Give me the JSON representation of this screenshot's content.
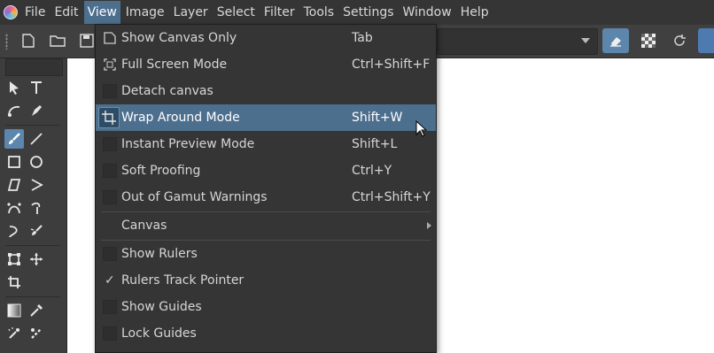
{
  "menubar": {
    "items": [
      {
        "label": "File"
      },
      {
        "label": "Edit"
      },
      {
        "label": "View"
      },
      {
        "label": "Image"
      },
      {
        "label": "Layer"
      },
      {
        "label": "Select"
      },
      {
        "label": "Filter"
      },
      {
        "label": "Tools"
      },
      {
        "label": "Settings"
      },
      {
        "label": "Window"
      },
      {
        "label": "Help"
      }
    ],
    "active": "View"
  },
  "view_menu": {
    "items": [
      {
        "label": "Show Canvas Only",
        "shortcut": "Tab",
        "icon": "canvas-only-icon"
      },
      {
        "label": "Full Screen Mode",
        "shortcut": "Ctrl+Shift+F",
        "icon": "fullscreen-icon"
      },
      {
        "label": "Detach canvas",
        "shortcut": "",
        "checkbox": true,
        "checked": false
      },
      {
        "label": "Wrap Around Mode",
        "shortcut": "Shift+W",
        "icon": "wrap-around-icon",
        "highlighted": true
      },
      {
        "label": "Instant Preview Mode",
        "shortcut": "Shift+L",
        "checkbox": true,
        "checked": false
      },
      {
        "label": "Soft Proofing",
        "shortcut": "Ctrl+Y",
        "checkbox": true,
        "checked": false
      },
      {
        "label": "Out of Gamut Warnings",
        "shortcut": "Ctrl+Shift+Y",
        "checkbox": true,
        "checked": false
      },
      {
        "label": "Canvas",
        "shortcut": "",
        "submenu": true
      },
      {
        "label": "Show Rulers",
        "shortcut": "",
        "checkbox": true,
        "checked": false
      },
      {
        "label": "Rulers Track Pointer",
        "shortcut": "",
        "checked": true,
        "tick": "✓"
      },
      {
        "label": "Show Guides",
        "shortcut": "",
        "checkbox": true,
        "checked": false
      },
      {
        "label": "Lock Guides",
        "shortcut": "",
        "checkbox": true,
        "checked": false
      }
    ]
  },
  "colors": {
    "accent": "#4d6f8e",
    "menu_bg": "#353535",
    "canvas": "#ffffff",
    "selected_tool": "#5c86ab"
  }
}
